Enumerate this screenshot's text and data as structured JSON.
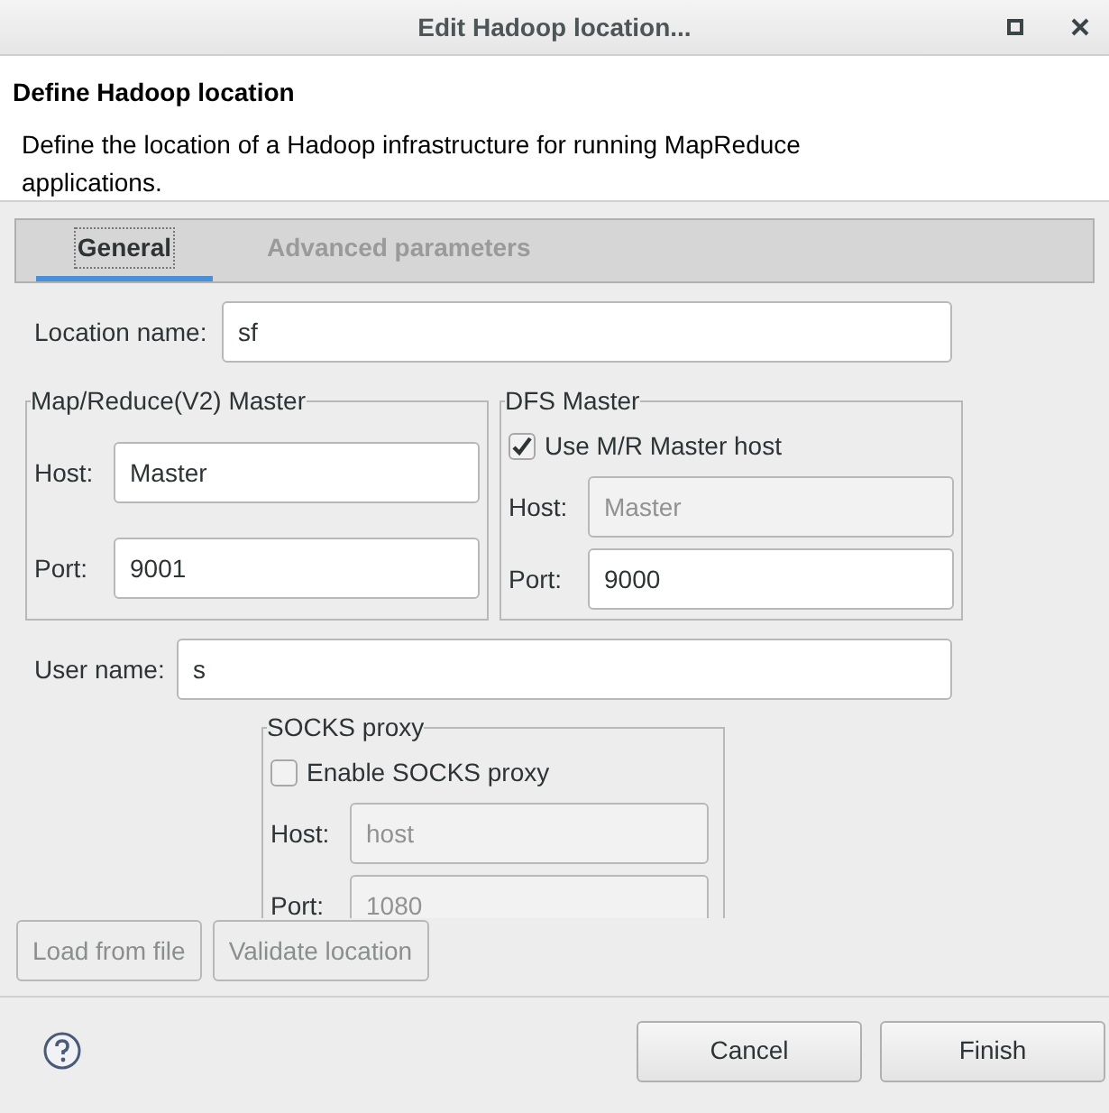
{
  "window": {
    "title": "Edit Hadoop location..."
  },
  "header": {
    "title": "Define Hadoop location",
    "description": "Define the location of a Hadoop infrastructure for running MapReduce applications."
  },
  "tabs": [
    {
      "label": "General",
      "selected": true
    },
    {
      "label": "Advanced parameters",
      "selected": false
    }
  ],
  "location_name": {
    "label": "Location name:",
    "value": "sf"
  },
  "mr_master": {
    "title": "Map/Reduce(V2) Master",
    "host": {
      "label": "Host:",
      "value": "Master"
    },
    "port": {
      "label": "Port:",
      "value": "9001"
    }
  },
  "dfs_master": {
    "title": "DFS Master",
    "use_mr_host": {
      "label": "Use M/R Master host",
      "checked": true
    },
    "host": {
      "label": "Host:",
      "value": "Master",
      "disabled": true
    },
    "port": {
      "label": "Port:",
      "value": "9000",
      "disabled": false
    }
  },
  "user_name": {
    "label": "User name:",
    "value": "s"
  },
  "socks_proxy": {
    "title": "SOCKS proxy",
    "enable": {
      "label": "Enable SOCKS proxy",
      "checked": false
    },
    "host": {
      "label": "Host:",
      "value": "host",
      "disabled": true
    },
    "port": {
      "label": "Port:",
      "value": "1080",
      "disabled": true
    }
  },
  "actions": [
    {
      "label": "Load from file",
      "disabled": true
    },
    {
      "label": "Validate location",
      "disabled": true
    }
  ],
  "footer_buttons": [
    {
      "label": "Cancel",
      "disabled": false
    },
    {
      "label": "Finish",
      "disabled": false
    }
  ]
}
